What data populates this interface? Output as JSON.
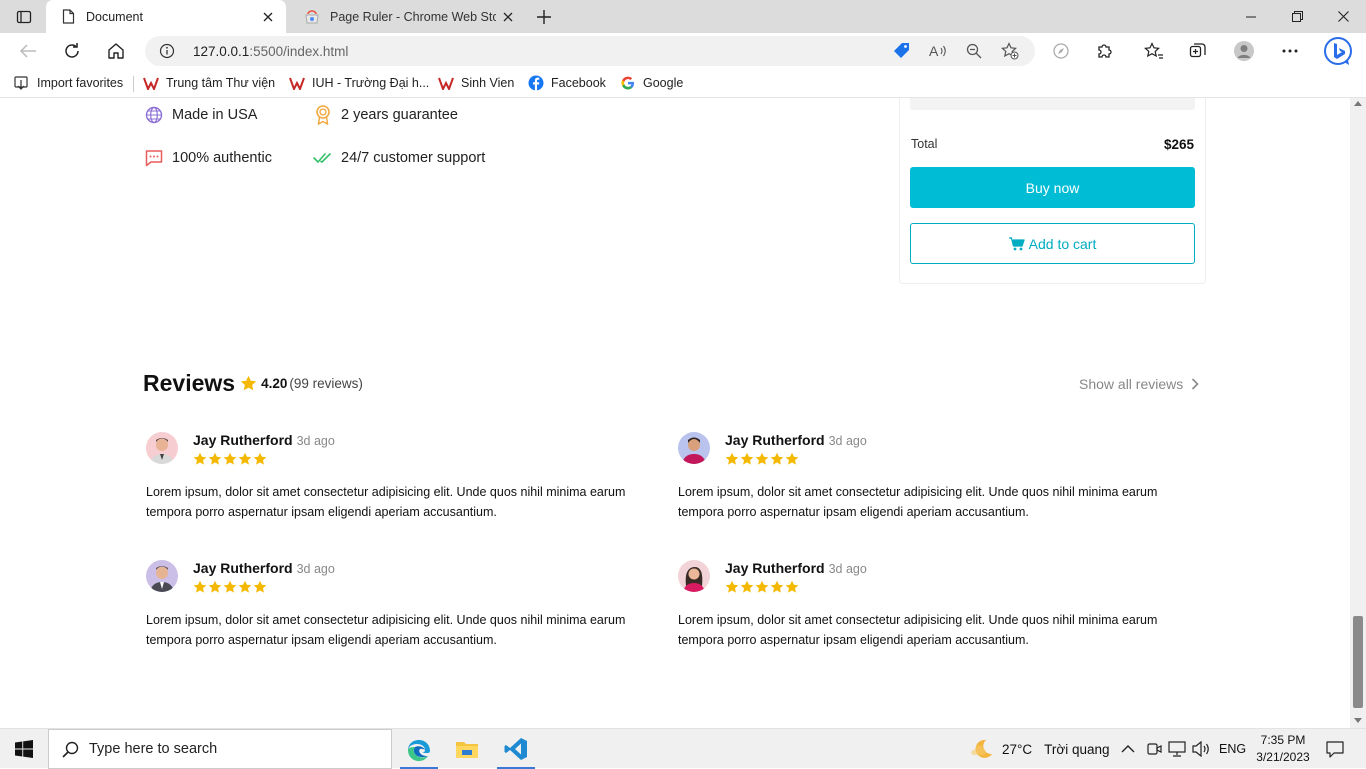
{
  "browser": {
    "tabs": [
      {
        "title": "Document",
        "active": true
      },
      {
        "title": "Page Ruler - Chrome Web Store",
        "active": false
      }
    ],
    "url_host": "127.0.0.1",
    "url_rest": ":5500/index.html",
    "favorites": [
      {
        "label": "Import favorites",
        "icon": "import-icon"
      },
      {
        "label": "Trung tâm Thư viện",
        "icon": "iuh-logo-icon"
      },
      {
        "label": "IUH - Trường Đại h...",
        "icon": "iuh-logo-icon"
      },
      {
        "label": "Sinh Vien",
        "icon": "iuh-logo-icon"
      },
      {
        "label": "Facebook",
        "icon": "facebook-icon"
      },
      {
        "label": "Google",
        "icon": "google-icon"
      }
    ]
  },
  "product": {
    "features": [
      {
        "label": "Made in USA",
        "icon": "globe-icon",
        "color": "#8b6fd6"
      },
      {
        "label": "2 years guarantee",
        "icon": "award-icon",
        "color": "#f0a63a"
      },
      {
        "label": "100% authentic",
        "icon": "chat-icon",
        "color": "#e85c5c"
      },
      {
        "label": "24/7 customer support",
        "icon": "double-check-icon",
        "color": "#34c06a"
      }
    ],
    "total_label": "Total",
    "total_value": "$265",
    "buy_label": "Buy now",
    "cart_label": "Add to cart",
    "accent_color": "#00bcd4"
  },
  "reviews": {
    "title": "Reviews",
    "rating": "4.20",
    "count": "(99 reviews)",
    "show_all": "Show all reviews",
    "items": [
      {
        "name": "Jay Rutherford",
        "time": "3d ago",
        "stars": 5,
        "text": "Lorem ipsum, dolor sit amet consectetur adipisicing elit. Unde quos nihil minima earum tempora porro aspernatur ipsam eligendi aperiam accusantium."
      },
      {
        "name": "Jay Rutherford",
        "time": "3d ago",
        "stars": 5,
        "text": "Lorem ipsum, dolor sit amet consectetur adipisicing elit. Unde quos nihil minima earum tempora porro aspernatur ipsam eligendi aperiam accusantium."
      },
      {
        "name": "Jay Rutherford",
        "time": "3d ago",
        "stars": 5,
        "text": "Lorem ipsum, dolor sit amet consectetur adipisicing elit. Unde quos nihil minima earum tempora porro aspernatur ipsam eligendi aperiam accusantium."
      },
      {
        "name": "Jay Rutherford",
        "time": "3d ago",
        "stars": 5,
        "text": "Lorem ipsum, dolor sit amet consectetur adipisicing elit. Unde quos nihil minima earum tempora porro aspernatur ipsam eligendi aperiam accusantium."
      }
    ]
  },
  "taskbar": {
    "search_placeholder": "Type here to search",
    "weather": "27°C",
    "weather_desc": "Trời quang",
    "language": "ENG",
    "time": "7:35 PM",
    "date": "3/21/2023"
  }
}
